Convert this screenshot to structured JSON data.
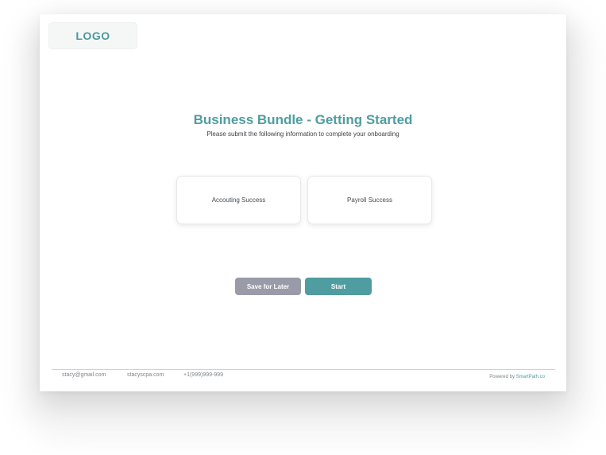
{
  "header": {
    "logo_text": "LOGO"
  },
  "main": {
    "title": "Business Bundle - Getting Started",
    "subtitle": "Please submit the following information to complete your onboarding",
    "options": [
      {
        "label": "Accouting Success"
      },
      {
        "label": "Payroll Success"
      }
    ],
    "save_label": "Save for Later",
    "start_label": "Start"
  },
  "footer": {
    "email": "stacy@gmail.com",
    "website": "stacyscpa.com",
    "phone": "+1(999)999-999",
    "powered_prefix": "Powered by ",
    "powered_brand": "SmartPath.co"
  },
  "colors": {
    "accent": "#4f9da0",
    "secondary_button": "#9a9ba9",
    "text": "#3e4348"
  }
}
